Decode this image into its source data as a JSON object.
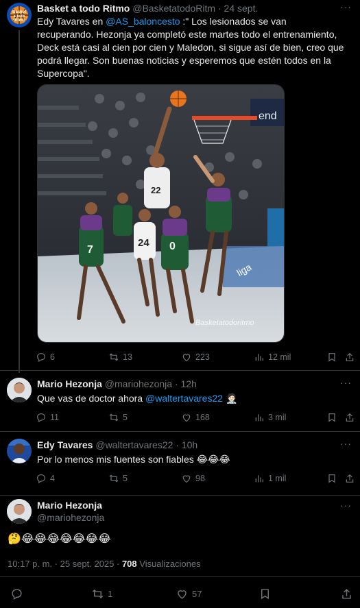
{
  "tweet1": {
    "name": "Basket a todo Ritmo",
    "handle": "@BasketatodoRitm",
    "date": "24 sept.",
    "avatar_text": "Basket a todo Ritmo",
    "text_prefix": "Edy Tavares en ",
    "mention": "@AS_baloncesto",
    "text_body": " :\" Los lesionados se van recuperando. Hezonja ya completó este martes todo el entrenamiento, Deck está casi al cien por cien y Maledon, si sigue así de bien, creo que podrá llegar. Son buenas noticias y esperemos que estén todos en la Supercopa\".",
    "watermark": "Basketatodoritmo",
    "jersey_a": "22",
    "jersey_b": "24",
    "jersey_c": "0",
    "jersey_d": "7",
    "banner": "end",
    "replies": "6",
    "retweets": "13",
    "likes": "223",
    "views": "12 mil"
  },
  "tweet2": {
    "name": "Mario Hezonja",
    "handle": "@mariohezonja",
    "time": "12h",
    "text": "Que vas de doctor ahora ",
    "mention": "@waltertavares22",
    "emoji": "🧑🏻‍⚕️",
    "replies": "11",
    "retweets": "5",
    "likes": "168",
    "views": "3 mil"
  },
  "tweet3": {
    "name": "Edy Tavares",
    "handle": "@waltertavares22",
    "time": "10h",
    "text": "Por lo menos mis fuentes son fiables 😂😂😂",
    "replies": "4",
    "retweets": "5",
    "likes": "98",
    "views": "1 mil"
  },
  "main": {
    "name": "Mario Hezonja",
    "handle": "@mariohezonja",
    "text": "🤔😂😂😂😂😂😂😂",
    "timestamp": "10:17 p. m. · 25 sept. 2025 · ",
    "views_count": "708",
    "views_label": " Visualizaciones",
    "retweets": "1",
    "likes": "57"
  },
  "separator": "·",
  "more_glyph": "···",
  "colors": {
    "link": "#1d9bf0",
    "muted": "#71767b",
    "bg": "#000000"
  }
}
